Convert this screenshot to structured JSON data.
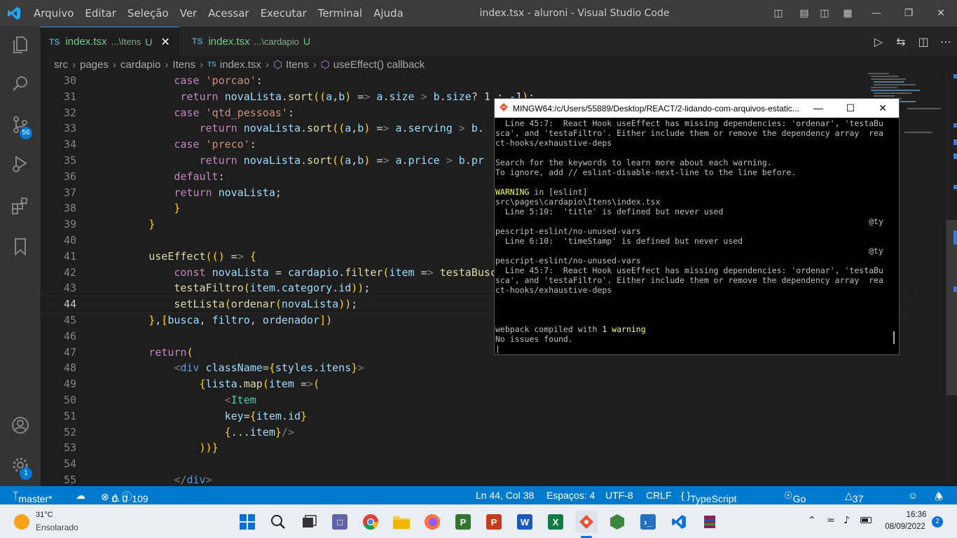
{
  "window": {
    "title": "index.tsx - aluroni - Visual Studio Code"
  },
  "menu": [
    "Arquivo",
    "Editar",
    "Seleção",
    "Ver",
    "Acessar",
    "Executar",
    "Terminal",
    "Ajuda"
  ],
  "tabs": [
    {
      "icon_text": "TS",
      "name": "index.tsx",
      "dir": "...\\Itens",
      "status": "U",
      "active": true
    },
    {
      "icon_text": "TS",
      "name": "index.tsx",
      "dir": "...\\cardapio",
      "status": "U",
      "active": false
    }
  ],
  "breadcrumb": [
    "src",
    "pages",
    "cardapio",
    "Itens",
    "index.tsx",
    "Itens",
    "useEffect() callback"
  ],
  "breadcrumb_ts": "TS",
  "activity": {
    "scm_badge": "56",
    "settings_badge": "1"
  },
  "editor": {
    "current_line": 44,
    "lines": [
      {
        "n": "30",
        "text": "            case 'porcao':"
      },
      {
        "n": "31",
        "text": "             return novaLista.sort((a,b) => a.size > b.size? 1 : -1);"
      },
      {
        "n": "32",
        "text": "            case 'qtd_pessoas':"
      },
      {
        "n": "33",
        "text": "                return novaLista.sort((a,b) => a.serving > b."
      },
      {
        "n": "34",
        "text": "            case 'preco':"
      },
      {
        "n": "35",
        "text": "                return novaLista.sort((a,b) => a.price > b.pr"
      },
      {
        "n": "36",
        "text": "            default:"
      },
      {
        "n": "37",
        "text": "            return novaLista;"
      },
      {
        "n": "38",
        "text": "            }"
      },
      {
        "n": "39",
        "text": "        }"
      },
      {
        "n": "40",
        "text": ""
      },
      {
        "n": "41",
        "text": "        useEffect(() => {"
      },
      {
        "n": "42",
        "text": "            const novaLista = cardapio.filter(item => testaBusca("
      },
      {
        "n": "43",
        "text": "            testaFiltro(item.category.id));"
      },
      {
        "n": "44",
        "text": "            setLista(ordenar(novaLista));"
      },
      {
        "n": "45",
        "text": "        },[busca, filtro, ordenador])"
      },
      {
        "n": "46",
        "text": ""
      },
      {
        "n": "47",
        "text": "        return("
      },
      {
        "n": "48",
        "text": "            <div className={styles.itens}>"
      },
      {
        "n": "49",
        "text": "                {lista.map(item =>("
      },
      {
        "n": "50",
        "text": "                    <Item"
      },
      {
        "n": "51",
        "text": "                    key={item.id}"
      },
      {
        "n": "52",
        "text": "                    {...item}/>"
      },
      {
        "n": "53",
        "text": "                ))}"
      },
      {
        "n": "54",
        "text": ""
      },
      {
        "n": "55",
        "text": "            </div>"
      }
    ]
  },
  "terminal": {
    "title": "MINGW64:/c/Users/55889/Desktop/REACT/2-lidando-com-arquivos-estatic...",
    "lines": [
      "  Line 45:7:  React Hook useEffect has missing dependencies: 'ordenar', 'testaBu",
      "sca', and 'testaFiltro'. Either include them or remove the dependency array  rea",
      "ct-hooks/exhaustive-deps",
      "",
      "Search for the keywords to learn more about each warning.",
      "To ignore, add // eslint-disable-next-line to the line before.",
      "",
      "[[W]] in [eslint]",
      "src\\pages\\cardapio\\Itens\\index.tsx",
      "  Line 5:10:  'title' is defined but never used",
      "                                                                             @ty",
      "pescript-eslint/no-unused-vars",
      "  Line 6:10:  'timeStamp' is defined but never used",
      "                                                                             @ty",
      "pescript-eslint/no-unused-vars",
      "  Line 45:7:  React Hook useEffect has missing dependencies: 'ordenar', 'testaBu",
      "sca', and 'testaFiltro'. Either include them or remove the dependency array  rea",
      "ct-hooks/exhaustive-deps",
      "",
      "",
      "",
      "webpack compiled with [[1 warning]]",
      "No issues found.",
      "|"
    ],
    "warning_word": "WARNING",
    "warning_count": "1 warning"
  },
  "status": {
    "branch": "master*",
    "errors": "0",
    "warnings": "0",
    "info": "109",
    "position": "Ln 44, Col 38",
    "spaces": "Espaços: 4",
    "encoding": "UTF-8",
    "eol": "CRLF",
    "language": "TypeScript React",
    "golive": "Go Live",
    "spell": "37 Spell",
    "notifications_icon": "bell-icon"
  },
  "taskbar": {
    "weather_temp": "31°C",
    "weather_desc": "Ensolarado",
    "time": "16:36",
    "date": "08/09/2022",
    "notif_count": "2"
  },
  "colors": {
    "accent": "#007acc",
    "titlebar": "#3c3c3c",
    "editor_bg": "#1e1e1e"
  }
}
